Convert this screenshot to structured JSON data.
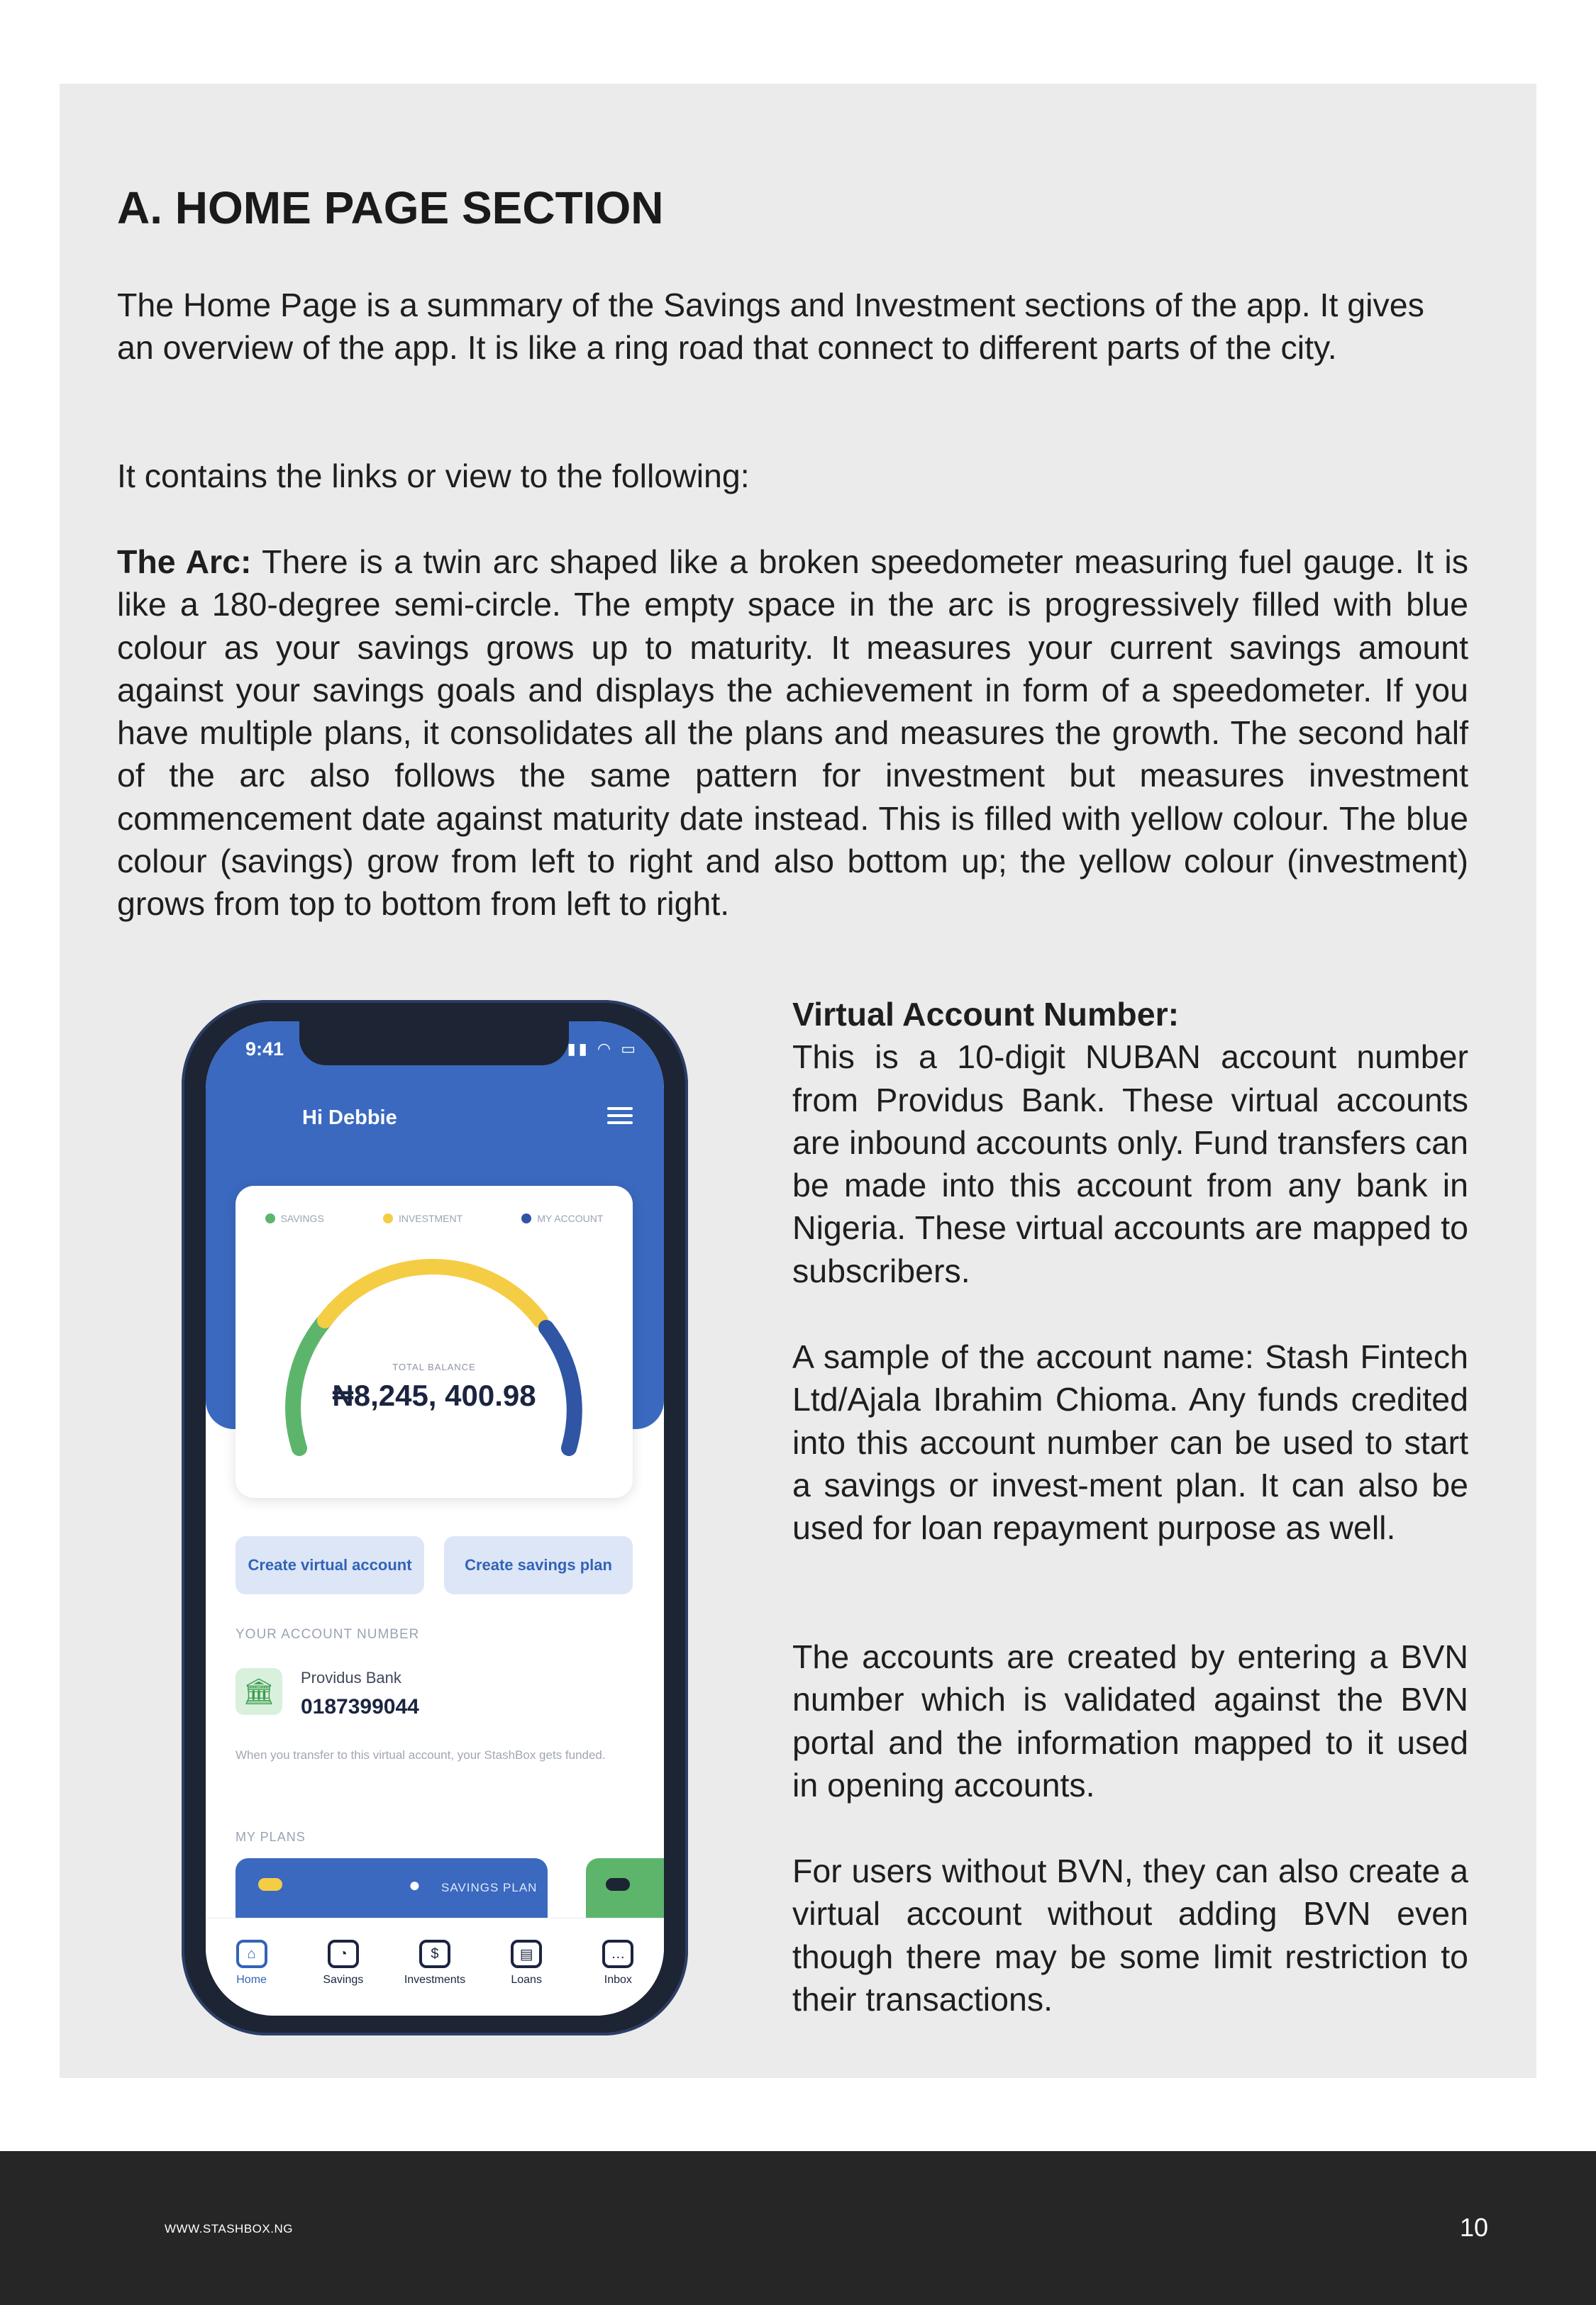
{
  "section_title": "A. HOME PAGE SECTION",
  "intro_paragraph": "The Home Page is a summary of the Savings and Investment sections of the app. It gives an overview of the app. It is like a ring road that connect to different parts of the city.",
  "contains_paragraph": "It contains the links or view to the following:",
  "arc": {
    "lead": "The Arc:",
    "text": " There is a twin arc shaped like a broken speedometer measuring fuel gauge. It is like a 180-degree semi-circle. The empty space in the arc is progressively filled with blue colour as your savings grows up to maturity. It measures your current savings amount against your savings goals and displays the achievement in form of a speedometer. If you have multiple plans, it consolidates all the plans and measures the growth.  The second half of the arc also follows the same pattern for investment but measures investment commencement date against maturity date instead. This is filled with yellow colour. The blue colour (savings) grow from left to right and also bottom up; the yellow colour (investment) grows from top to bottom from left to right."
  },
  "virtual_account": {
    "heading": "Virtual Account Number:",
    "p1": "This is a 10-digit NUBAN account number from Providus Bank. These virtual accounts are inbound accounts only. Fund transfers can be made into this account from any bank in Nigeria. These virtual accounts are mapped to subscribers.",
    "p2": "A sample of the account name: Stash Fintech Ltd/Ajala Ibrahim Chioma. Any funds credited into this account number can be used to start a savings or invest-ment plan. It can also be used for loan repayment purpose as well.",
    "p3": "The accounts are created by entering a BVN number which is validated against the BVN portal and the information mapped to it used in opening accounts.",
    "p4": "For users without BVN, they can also create a virtual account without adding BVN even though there may be some limit restriction to their transactions."
  },
  "phone": {
    "time": "9:41",
    "status_icons": "▮▮ ◠ ▭",
    "greeting": "Hi Debbie",
    "legend": [
      {
        "label": "SAVINGS",
        "color": "#5db56c"
      },
      {
        "label": "INVESTMENT",
        "color": "#f4cd45"
      },
      {
        "label": "MY ACCOUNT",
        "color": "#2f55a4"
      }
    ],
    "gauge": {
      "green_color": "#5db56c",
      "yellow_color": "#f4cd45",
      "blue_color": "#2f55a4"
    },
    "total_balance_label": "TOTAL BALANCE",
    "total_balance_value": "₦8,245, 400.98",
    "create_virtual_account": "Create virtual account",
    "create_savings_plan": "Create savings plan",
    "account_number_label": "YOUR ACCOUNT NUMBER",
    "bank_icon": "bank-icon",
    "bank_name": "Providus Bank",
    "account_number": "0187399044",
    "account_note": "When you transfer to this virtual account, your StashBox gets funded.",
    "plans_label": "MY PLANS",
    "plan_label": "SAVINGS PLAN",
    "tabs": [
      {
        "label": "Home",
        "icon": "home-icon"
      },
      {
        "label": "Savings",
        "icon": "piggy-bank-icon"
      },
      {
        "label": "Investments",
        "icon": "money-icon"
      },
      {
        "label": "Loans",
        "icon": "loans-icon"
      },
      {
        "label": "Inbox",
        "icon": "inbox-icon"
      }
    ]
  },
  "footer": {
    "url": "WWW.STASHBOX.NG",
    "page_number": "10"
  }
}
